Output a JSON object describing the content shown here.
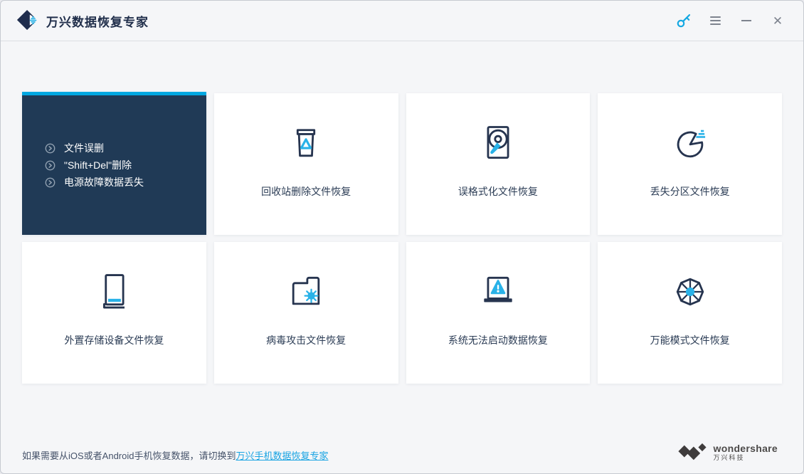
{
  "header": {
    "title": "万兴数据恢复专家"
  },
  "selected_card": {
    "items": [
      "文件误删",
      "\"Shift+Del\"删除",
      "电源故障数据丢失"
    ]
  },
  "cards": [
    {
      "label": "回收站删除文件恢复",
      "icon": "recycle-bin-icon"
    },
    {
      "label": "误格式化文件恢复",
      "icon": "formatted-disk-icon"
    },
    {
      "label": "丢失分区文件恢复",
      "icon": "lost-partition-icon"
    },
    {
      "label": "外置存储设备文件恢复",
      "icon": "external-device-icon"
    },
    {
      "label": "病毒攻击文件恢复",
      "icon": "virus-attack-icon"
    },
    {
      "label": "系统无法启动数据恢复",
      "icon": "system-crash-icon"
    },
    {
      "label": "万能模式文件恢复",
      "icon": "all-around-recovery-icon"
    }
  ],
  "footer": {
    "note": "如果需要从iOS或者Android手机恢复数据，请切换到",
    "link": "万兴手机数据恢复专家",
    "brand_name": "wondershare",
    "brand_cn": "万兴科技"
  },
  "colors": {
    "accent_cyan": "#00a7e1",
    "icon_cyan": "#29b2e8",
    "dark_navy": "#203a56",
    "icon_stroke": "#26344f",
    "link_blue": "#17a3e2"
  }
}
